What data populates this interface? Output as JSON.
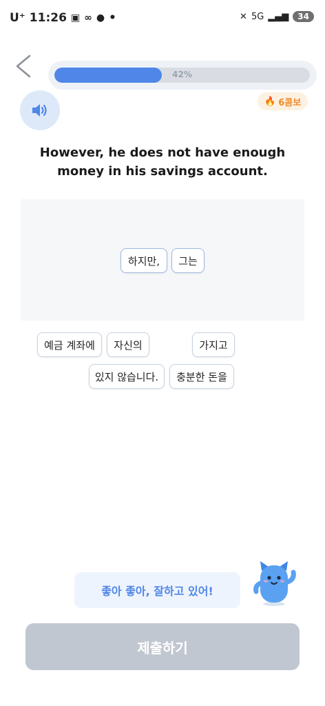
{
  "status_bar": {
    "carrier": "U⁺",
    "time": "11:26",
    "dot": "•",
    "network": "5G",
    "battery": "34"
  },
  "progress": {
    "label": "42%",
    "value": 0.42
  },
  "combo": {
    "label": "6콤보"
  },
  "sentence": "However, he does not have enough money in his savings account.",
  "answer_chips": [
    "하지만,",
    "그는"
  ],
  "word_bank": [
    "예금 계좌에",
    "자신의",
    "가지고",
    "있지 않습니다.",
    "충분한 돈을"
  ],
  "encouragement": "좋아 좋아, 잘하고 있어!",
  "submit_label": "제출하기",
  "colors": {
    "accent": "#4f86e8",
    "combo": "#f08a2c",
    "submit_disabled": "#c1c7d1"
  }
}
